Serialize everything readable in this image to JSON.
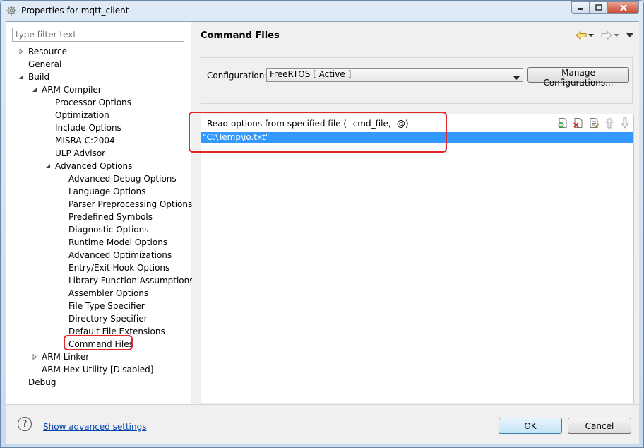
{
  "window": {
    "title": "Properties for mqtt_client",
    "app_icon": "gear-icon",
    "controls": [
      "minimize-icon",
      "maximize-icon",
      "close-icon"
    ]
  },
  "filter": {
    "placeholder": "type filter text",
    "value": ""
  },
  "tree": [
    {
      "label": "Resource",
      "depth": 0,
      "toggle": "collapsed"
    },
    {
      "label": "General",
      "depth": 0,
      "toggle": "none"
    },
    {
      "label": "Build",
      "depth": 0,
      "toggle": "expanded"
    },
    {
      "label": "ARM Compiler",
      "depth": 1,
      "toggle": "expanded"
    },
    {
      "label": "Processor Options",
      "depth": 2,
      "toggle": "none"
    },
    {
      "label": "Optimization",
      "depth": 2,
      "toggle": "none"
    },
    {
      "label": "Include Options",
      "depth": 2,
      "toggle": "none"
    },
    {
      "label": "MISRA-C:2004",
      "depth": 2,
      "toggle": "none"
    },
    {
      "label": "ULP Advisor",
      "depth": 2,
      "toggle": "none"
    },
    {
      "label": "Advanced Options",
      "depth": 2,
      "toggle": "expanded"
    },
    {
      "label": "Advanced Debug Options",
      "depth": 3,
      "toggle": "none"
    },
    {
      "label": "Language Options",
      "depth": 3,
      "toggle": "none"
    },
    {
      "label": "Parser Preprocessing Options",
      "depth": 3,
      "toggle": "none"
    },
    {
      "label": "Predefined Symbols",
      "depth": 3,
      "toggle": "none"
    },
    {
      "label": "Diagnostic Options",
      "depth": 3,
      "toggle": "none"
    },
    {
      "label": "Runtime Model Options",
      "depth": 3,
      "toggle": "none"
    },
    {
      "label": "Advanced Optimizations",
      "depth": 3,
      "toggle": "none"
    },
    {
      "label": "Entry/Exit Hook Options",
      "depth": 3,
      "toggle": "none"
    },
    {
      "label": "Library Function Assumptions",
      "depth": 3,
      "toggle": "none"
    },
    {
      "label": "Assembler Options",
      "depth": 3,
      "toggle": "none"
    },
    {
      "label": "File Type Specifier",
      "depth": 3,
      "toggle": "none"
    },
    {
      "label": "Directory Specifier",
      "depth": 3,
      "toggle": "none"
    },
    {
      "label": "Default File Extensions",
      "depth": 3,
      "toggle": "none"
    },
    {
      "label": "Command Files",
      "depth": 3,
      "toggle": "none",
      "selected": true
    },
    {
      "label": "ARM Linker",
      "depth": 1,
      "toggle": "collapsed"
    },
    {
      "label": "ARM Hex Utility  [Disabled]",
      "depth": 1,
      "toggle": "none"
    },
    {
      "label": "Debug",
      "depth": 0,
      "toggle": "none"
    }
  ],
  "page": {
    "title": "Command Files",
    "nav_icons": [
      "back-arrow-icon",
      "back-dropdown-icon",
      "forward-arrow-icon",
      "forward-dropdown-icon",
      "view-menu-icon"
    ]
  },
  "configuration": {
    "label": "Configuration:",
    "selected": "FreeRTOS  [ Active ]",
    "manage_label": "Manage Configurations..."
  },
  "options": {
    "title": "Read options from specified file (--cmd_file, -@)",
    "items": [
      "\"C:\\Temp\\io.txt\""
    ],
    "tools": [
      "add-icon",
      "delete-icon",
      "edit-icon",
      "move-up-icon",
      "move-down-icon"
    ]
  },
  "footer": {
    "advanced_link": "Show advanced settings",
    "ok_label": "OK",
    "cancel_label": "Cancel"
  },
  "colors": {
    "selection": "#3399ff",
    "highlight": "#e0262b",
    "link": "#0645ad"
  }
}
